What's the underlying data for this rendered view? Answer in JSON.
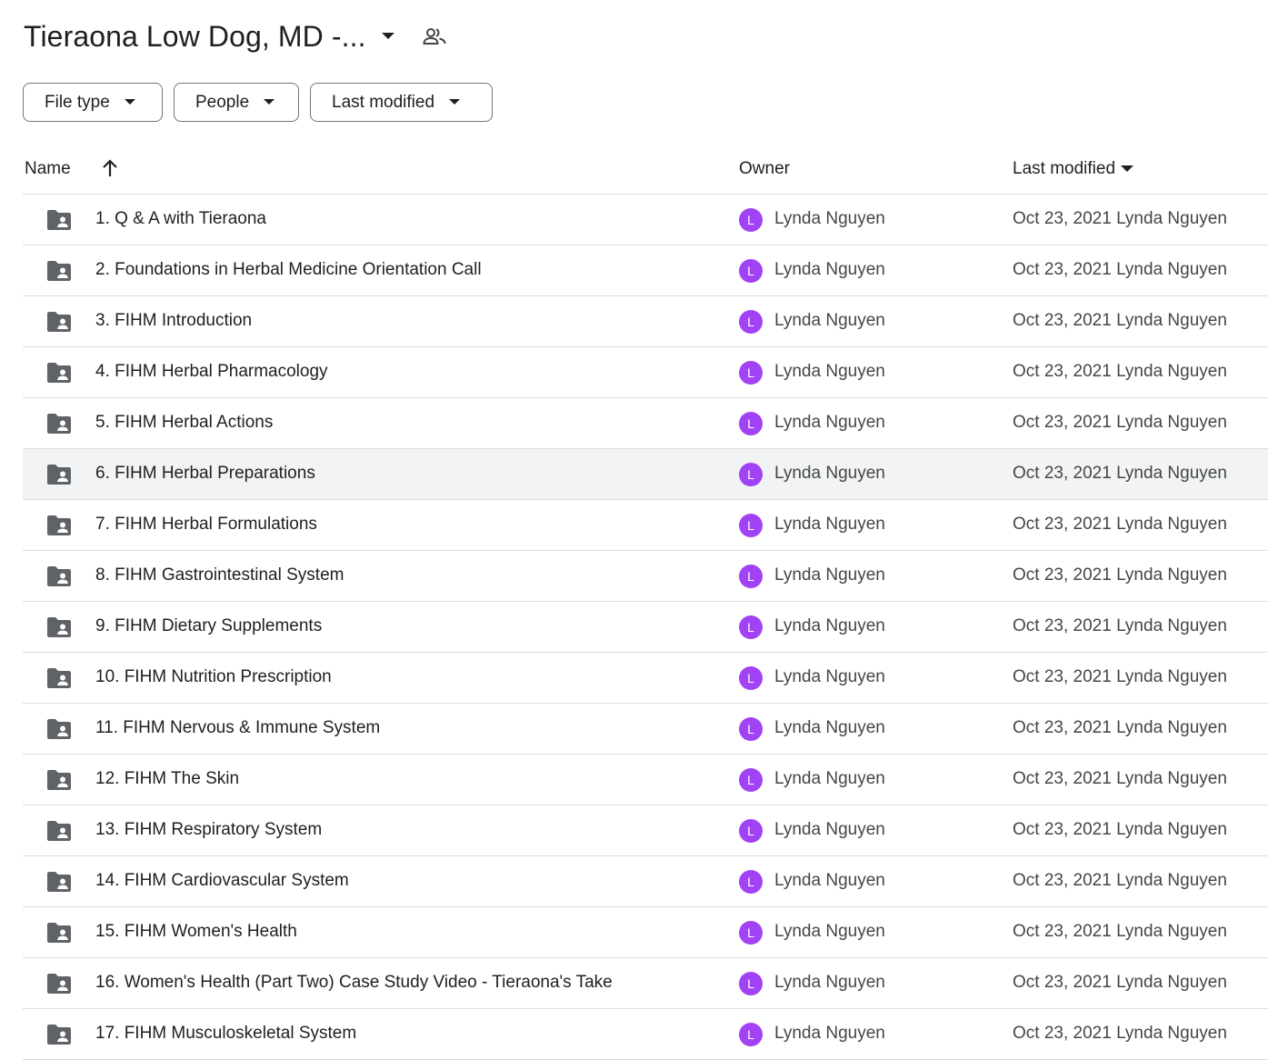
{
  "header": {
    "title": "Tieraona Low Dog, MD -...",
    "title_caret_icon": "arrow-drop-down-icon",
    "share_icon": "people-icon"
  },
  "filters": [
    {
      "label": "File type"
    },
    {
      "label": "People"
    },
    {
      "label": "Last modified"
    }
  ],
  "columns": {
    "name": "Name",
    "owner": "Owner",
    "last_modified": "Last modified",
    "sort_icon": "arrow-upward-icon"
  },
  "colors": {
    "avatar": "#a142f4",
    "selected_row": "#f1f3f4",
    "folder": "#5f6368"
  },
  "rows": [
    {
      "name": "1. Q & A with Tieraona",
      "avatar": "L",
      "owner": "Lynda Nguyen",
      "modified": "Oct 23, 2021 Lynda Nguyen"
    },
    {
      "name": "2. Foundations in Herbal Medicine Orientation Call",
      "avatar": "L",
      "owner": "Lynda Nguyen",
      "modified": "Oct 23, 2021 Lynda Nguyen"
    },
    {
      "name": "3. FIHM Introduction",
      "avatar": "L",
      "owner": "Lynda Nguyen",
      "modified": "Oct 23, 2021 Lynda Nguyen"
    },
    {
      "name": "4. FIHM Herbal Pharmacology",
      "avatar": "L",
      "owner": "Lynda Nguyen",
      "modified": "Oct 23, 2021 Lynda Nguyen"
    },
    {
      "name": "5. FIHM Herbal Actions",
      "avatar": "L",
      "owner": "Lynda Nguyen",
      "modified": "Oct 23, 2021 Lynda Nguyen"
    },
    {
      "name": "6. FIHM Herbal Preparations",
      "avatar": "L",
      "owner": "Lynda Nguyen",
      "modified": "Oct 23, 2021 Lynda Nguyen",
      "selected": true
    },
    {
      "name": "7. FIHM Herbal Formulations",
      "avatar": "L",
      "owner": "Lynda Nguyen",
      "modified": "Oct 23, 2021 Lynda Nguyen"
    },
    {
      "name": "8. FIHM Gastrointestinal System",
      "avatar": "L",
      "owner": "Lynda Nguyen",
      "modified": "Oct 23, 2021 Lynda Nguyen"
    },
    {
      "name": "9. FIHM Dietary Supplements",
      "avatar": "L",
      "owner": "Lynda Nguyen",
      "modified": "Oct 23, 2021 Lynda Nguyen"
    },
    {
      "name": "10. FIHM Nutrition Prescription",
      "avatar": "L",
      "owner": "Lynda Nguyen",
      "modified": "Oct 23, 2021 Lynda Nguyen"
    },
    {
      "name": "11. FIHM Nervous & Immune System",
      "avatar": "L",
      "owner": "Lynda Nguyen",
      "modified": "Oct 23, 2021 Lynda Nguyen"
    },
    {
      "name": "12. FIHM The Skin",
      "avatar": "L",
      "owner": "Lynda Nguyen",
      "modified": "Oct 23, 2021 Lynda Nguyen"
    },
    {
      "name": "13. FIHM Respiratory System",
      "avatar": "L",
      "owner": "Lynda Nguyen",
      "modified": "Oct 23, 2021 Lynda Nguyen"
    },
    {
      "name": "14. FIHM Cardiovascular System",
      "avatar": "L",
      "owner": "Lynda Nguyen",
      "modified": "Oct 23, 2021 Lynda Nguyen"
    },
    {
      "name": "15. FIHM Women's Health",
      "avatar": "L",
      "owner": "Lynda Nguyen",
      "modified": "Oct 23, 2021 Lynda Nguyen"
    },
    {
      "name": "16. Women's Health (Part Two) Case Study Video - Tieraona's Take",
      "avatar": "L",
      "owner": "Lynda Nguyen",
      "modified": "Oct 23, 2021 Lynda Nguyen"
    },
    {
      "name": "17. FIHM Musculoskeletal System",
      "avatar": "L",
      "owner": "Lynda Nguyen",
      "modified": "Oct 23, 2021 Lynda Nguyen"
    }
  ]
}
